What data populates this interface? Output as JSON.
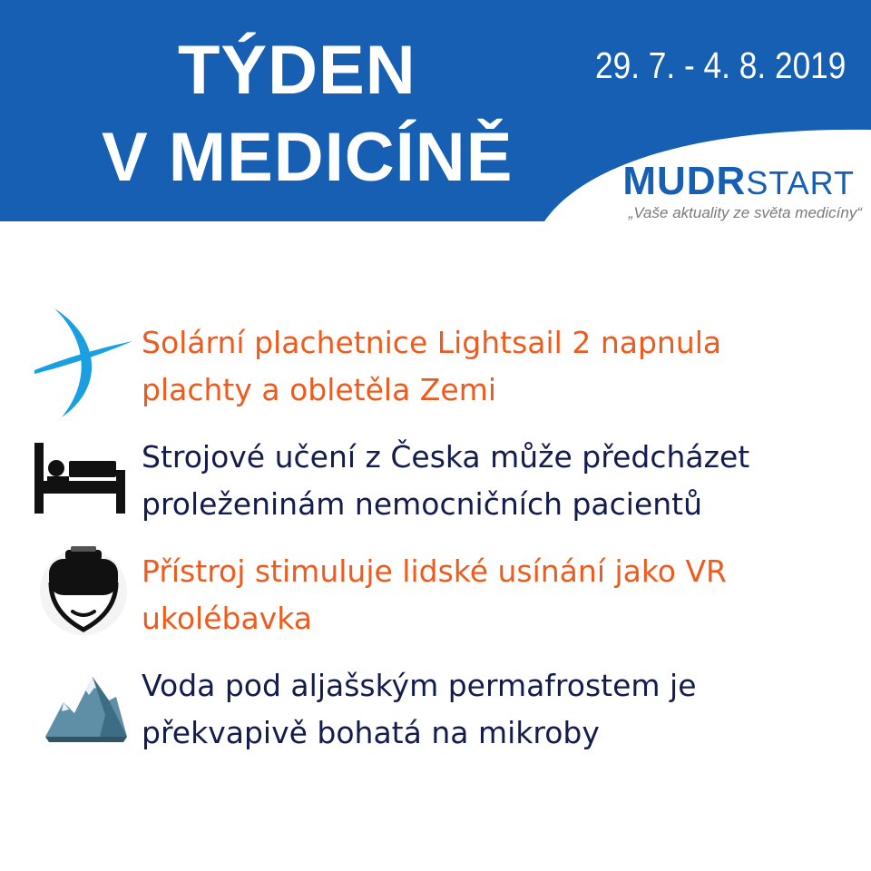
{
  "header": {
    "title_line_1": "TÝDEN",
    "title_line_2": "V MEDICÍNĚ",
    "date_range": "29. 7. - 4. 8. 2019",
    "brand_bold": "MUDR",
    "brand_light": "START",
    "tagline": "„Vaše aktuality ze světa medicíny“"
  },
  "colors": {
    "header_blue": "#165fb3",
    "headline_orange": "#ef5b1c",
    "headline_navy": "#141c4e"
  },
  "items": [
    {
      "icon": "sail-swoosh-icon",
      "line_1": "Solární plachetnice Lightsail 2 napnula",
      "line_2": "plachty a obletěla Zemi",
      "color": "orange"
    },
    {
      "icon": "hospital-bed-icon",
      "line_1": "Strojové učení z Česka může předcházet",
      "line_2": "proleženinám nemocničních pacientů",
      "color": "navy"
    },
    {
      "icon": "vr-headset-icon",
      "line_1": "Přístroj stimuluje lidské usínání jako VR",
      "line_2": "ukolébavka",
      "color": "orange"
    },
    {
      "icon": "mountain-icon",
      "line_1": "Voda pod aljašským permafrostem je",
      "line_2": "překvapivě bohatá na mikroby",
      "color": "navy"
    }
  ]
}
